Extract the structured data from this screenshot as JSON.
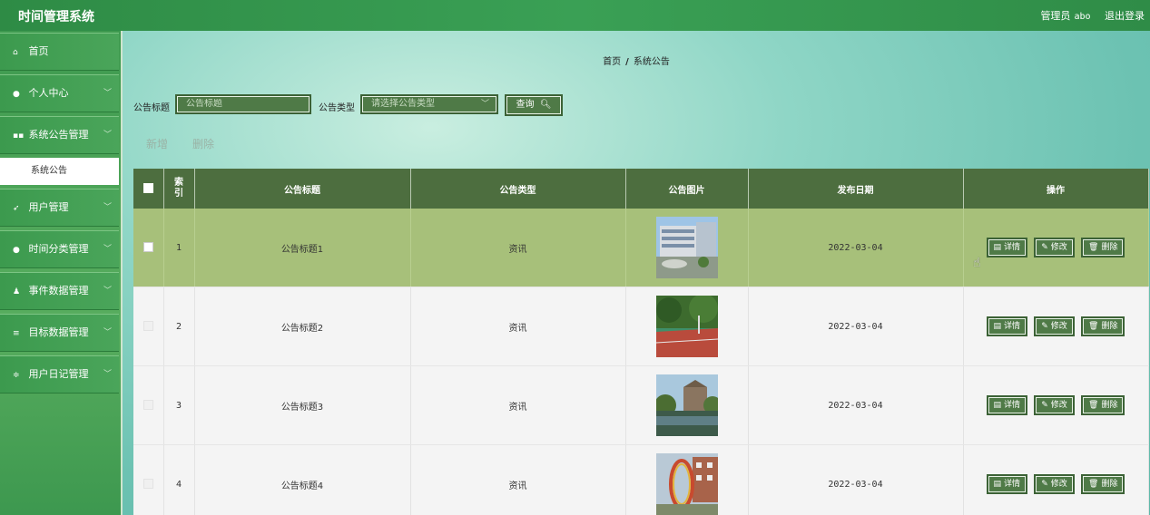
{
  "app": {
    "title": "时间管理系统"
  },
  "header": {
    "role": "管理员",
    "user": "abo",
    "logout": "退出登录"
  },
  "sidebar": {
    "items": [
      {
        "label": "首页",
        "icon": "home-icon",
        "glyph": "⌂"
      },
      {
        "label": "个人中心",
        "icon": "user-icon",
        "glyph": "●"
      },
      {
        "label": "系统公告管理",
        "icon": "grid-icon",
        "glyph": "▪▪"
      },
      {
        "label": "用户管理",
        "icon": "send-icon",
        "glyph": "➶"
      },
      {
        "label": "时间分类管理",
        "icon": "pin-icon",
        "glyph": "●"
      },
      {
        "label": "事件数据管理",
        "icon": "person-icon",
        "glyph": "♟"
      },
      {
        "label": "目标数据管理",
        "icon": "list-icon",
        "glyph": "≡"
      },
      {
        "label": "用户日记管理",
        "icon": "sliders-icon",
        "glyph": "≑"
      }
    ],
    "sub_active": "系统公告"
  },
  "breadcrumb": {
    "home": "首页",
    "sep": "/",
    "current": "系统公告"
  },
  "filters": {
    "title_label": "公告标题",
    "title_placeholder": "公告标题",
    "type_label": "公告类型",
    "type_placeholder": "请选择公告类型",
    "query_label": "查询"
  },
  "actions": {
    "add": "新增",
    "delete": "删除"
  },
  "table": {
    "headers": {
      "index": "索引",
      "title": "公告标题",
      "type": "公告类型",
      "image": "公告图片",
      "date": "发布日期",
      "ops": "操作"
    },
    "op_labels": {
      "detail": "详情",
      "edit": "修改",
      "delete": "删除"
    },
    "rows": [
      {
        "index": "1",
        "title": "公告标题1",
        "type": "资讯",
        "date": "2022-03-04"
      },
      {
        "index": "2",
        "title": "公告标题2",
        "type": "资讯",
        "date": "2022-03-04"
      },
      {
        "index": "3",
        "title": "公告标题3",
        "type": "资讯",
        "date": "2022-03-04"
      },
      {
        "index": "4",
        "title": "公告标题4",
        "type": "资讯",
        "date": "2022-03-04"
      }
    ]
  },
  "colors": {
    "header_bar": "#3aa055",
    "table_header": "#4d6e3f",
    "selected_row": "#a7c07a",
    "button": "#4f7a47"
  }
}
